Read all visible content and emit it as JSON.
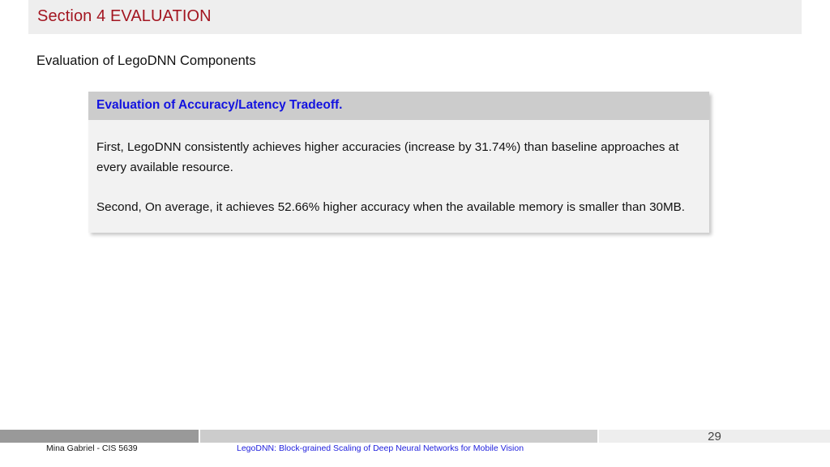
{
  "slide": {
    "section_band": {
      "title": "Section 4 EVALUATION",
      "accent_color": "#a31621",
      "background_color": "#eeeeee"
    },
    "subtitle": "Evaluation of LegoDNN Components",
    "callout": {
      "header": "Evaluation of Accuracy/Latency Tradeoff.",
      "header_color": "#1313e0",
      "header_background": "#cccccc",
      "body_background": "#f2f2f2",
      "paragraphs": [
        "First, LegoDNN consistently achieves higher accuracies (increase by 31.74%) than baseline approaches at every available resource.",
        "Second, On average, it achieves 52.66% higher accuracy when the available memory is smaller than 30MB."
      ]
    },
    "footer": {
      "author": "Mina Gabriel - CIS  5639",
      "paper_title": "LegoDNN: Block-grained Scaling of Deep Neural Networks for Mobile Vision",
      "paper_title_color": "#2222dd",
      "page_number": "29",
      "bar_colors": {
        "left": "#999999",
        "middle": "#cccccc",
        "right": "#eeeeee"
      }
    }
  }
}
